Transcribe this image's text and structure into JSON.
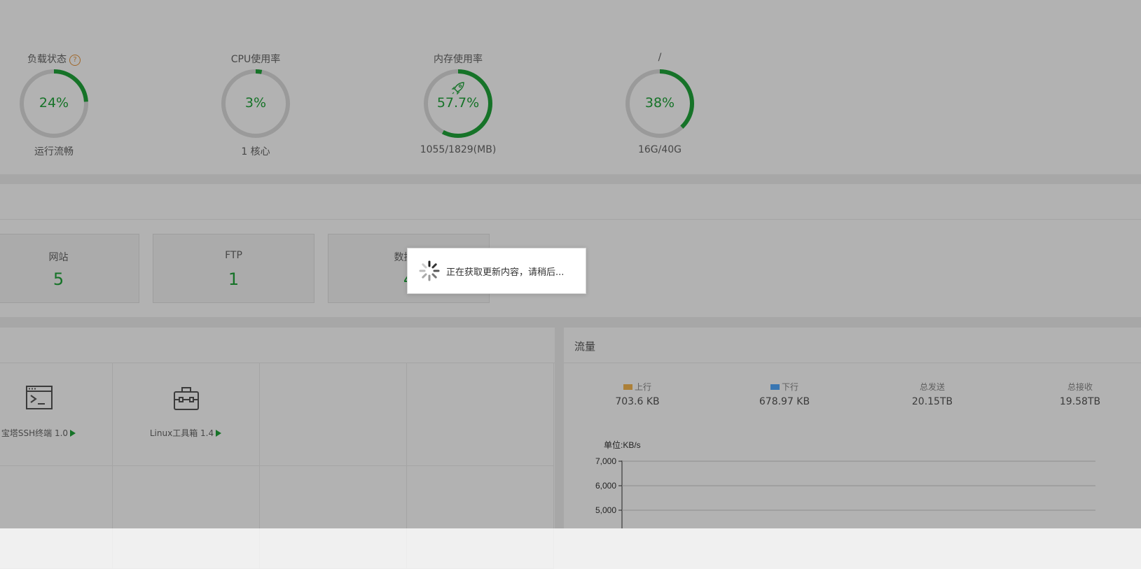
{
  "status": {
    "gauges": [
      {
        "title": "负载状态",
        "help": "?",
        "percent": 24,
        "value": "24%",
        "sub": "运行流畅"
      },
      {
        "title": "CPU使用率",
        "percent": 3,
        "value": "3%",
        "sub": "1 核心"
      },
      {
        "title": "内存使用率",
        "percent": 57.7,
        "value": "57.7%",
        "sub": "1055/1829(MB)",
        "icon": "rocket-icon"
      },
      {
        "title": "/",
        "percent": 38,
        "value": "38%",
        "sub": "16G/40G"
      }
    ]
  },
  "overview": {
    "cards": [
      {
        "label": "网站",
        "value": "5"
      },
      {
        "label": "FTP",
        "value": "1"
      },
      {
        "label": "数据库",
        "value": "4"
      }
    ]
  },
  "software": {
    "items": [
      {
        "label": "宝塔SSH终端 1.0",
        "icon": "terminal-icon"
      },
      {
        "label": "Linux工具箱 1.4",
        "icon": "toolbox-icon"
      }
    ]
  },
  "traffic": {
    "title": "流量",
    "stats": [
      {
        "label": "上行",
        "value": "703.6 KB",
        "color": "#f7b851"
      },
      {
        "label": "下行",
        "value": "678.97 KB",
        "color": "#52a9ff"
      },
      {
        "label": "总发送",
        "value": "20.15TB"
      },
      {
        "label": "总接收",
        "value": "19.58TB"
      }
    ],
    "unit": "单位:KB/s",
    "y_ticks": [
      "7,000",
      "6,000",
      "5,000"
    ]
  },
  "loading": {
    "text": "正在获取更新内容，请稍后..."
  },
  "colors": {
    "accent": "#20a53a",
    "track": "#dddddd",
    "help": "#e5943d"
  }
}
